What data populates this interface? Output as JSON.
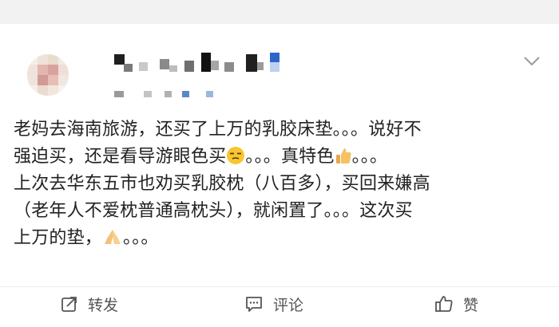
{
  "post": {
    "line1": "老妈去海南旅游，还买了上万的乳胶床垫。。。说好不",
    "line2_a": "强迫买，还是看导游眼色买",
    "line2_b": "。。。真特色",
    "line2_c": "。。。",
    "line3": "上次去华东五市也劝买乳胶枕（八百多），买回来嫌高",
    "line4": "（老年人不爱枕普通高枕头），就闲置了。。。这次买",
    "line5_a": "上万的垫，",
    "line5_b": "。。。"
  },
  "actions": {
    "repost_label": "转发",
    "comment_label": "评论",
    "like_label": "赞"
  },
  "icons": {
    "header_menu": "chevron-down-icon",
    "emoji_1": "unamused-face-emoji",
    "emoji_2": "thumbs-up-emoji",
    "emoji_3": "pray-hands-emoji",
    "repost": "repost-icon",
    "comment": "comment-icon",
    "like": "like-icon"
  },
  "colors": {
    "text": "#222222",
    "action_text": "#555555",
    "background_band": "#f2f2f2"
  }
}
